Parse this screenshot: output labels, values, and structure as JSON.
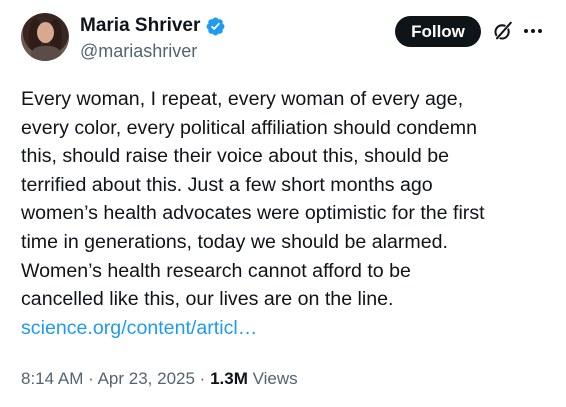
{
  "author": {
    "display_name": "Maria Shriver",
    "handle": "@mariashriver",
    "verified": true,
    "verified_color": "#1d9bf0"
  },
  "actions": {
    "follow_label": "Follow",
    "grok_icon": "grok-icon",
    "more_icon": "more-icon"
  },
  "tweet": {
    "text": "Every woman, I repeat, every woman of every age,\nevery color, every political affiliation should condemn\nthis, should raise their voice about this, should be\nterrified about this. Just a few short months ago\nwomen’s health advocates were optimistic for the first\ntime in generations, today we should be alarmed.\nWomen’s health research cannot afford to be\ncancelled like this, our lives are on the line.",
    "link": "science.org/content/articl…",
    "link_color": "#1d9bf0"
  },
  "meta": {
    "time": "8:14 AM",
    "separator": "·",
    "date": "Apr 23, 2025",
    "views_count": "1.3M",
    "views_label": "Views"
  }
}
